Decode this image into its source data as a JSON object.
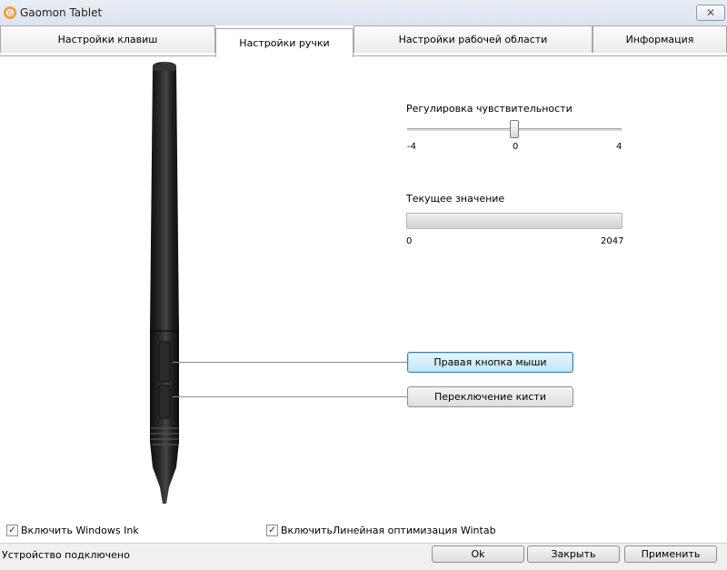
{
  "window": {
    "title": "Gaomon Tablet",
    "close_glyph": "✕"
  },
  "tabs": [
    {
      "label": "Настройки клавиш"
    },
    {
      "label": "Настройки ручки",
      "active": true
    },
    {
      "label": "Настройки рабочей области"
    },
    {
      "label": "Информация"
    }
  ],
  "sensitivity": {
    "label": "Регулировка чувствительности",
    "min": "-4",
    "mid": "0",
    "max": "4",
    "value": 0
  },
  "current_value": {
    "label": "Текущее значение",
    "min": "0",
    "max": "2047",
    "value": 0
  },
  "pen_buttons": {
    "upper": "Правая кнопка мыши",
    "lower": "Переключение кисти"
  },
  "options": {
    "windows_ink": {
      "label": "Включить Windows Ink",
      "checked": true
    },
    "wintab": {
      "label": "ВключитьЛинейная оптимизация Wintab",
      "checked": true
    }
  },
  "status": {
    "text": "Устройство подключено"
  },
  "footer_buttons": {
    "ok": "Ok",
    "close": "Закрыть",
    "apply": "Применить"
  },
  "icons": {
    "app": "gaomon-logo-icon",
    "check": "checkmark-icon"
  },
  "colors": {
    "accent_focus": "#3c7fb1",
    "pen_body": "#1b1b1b"
  }
}
